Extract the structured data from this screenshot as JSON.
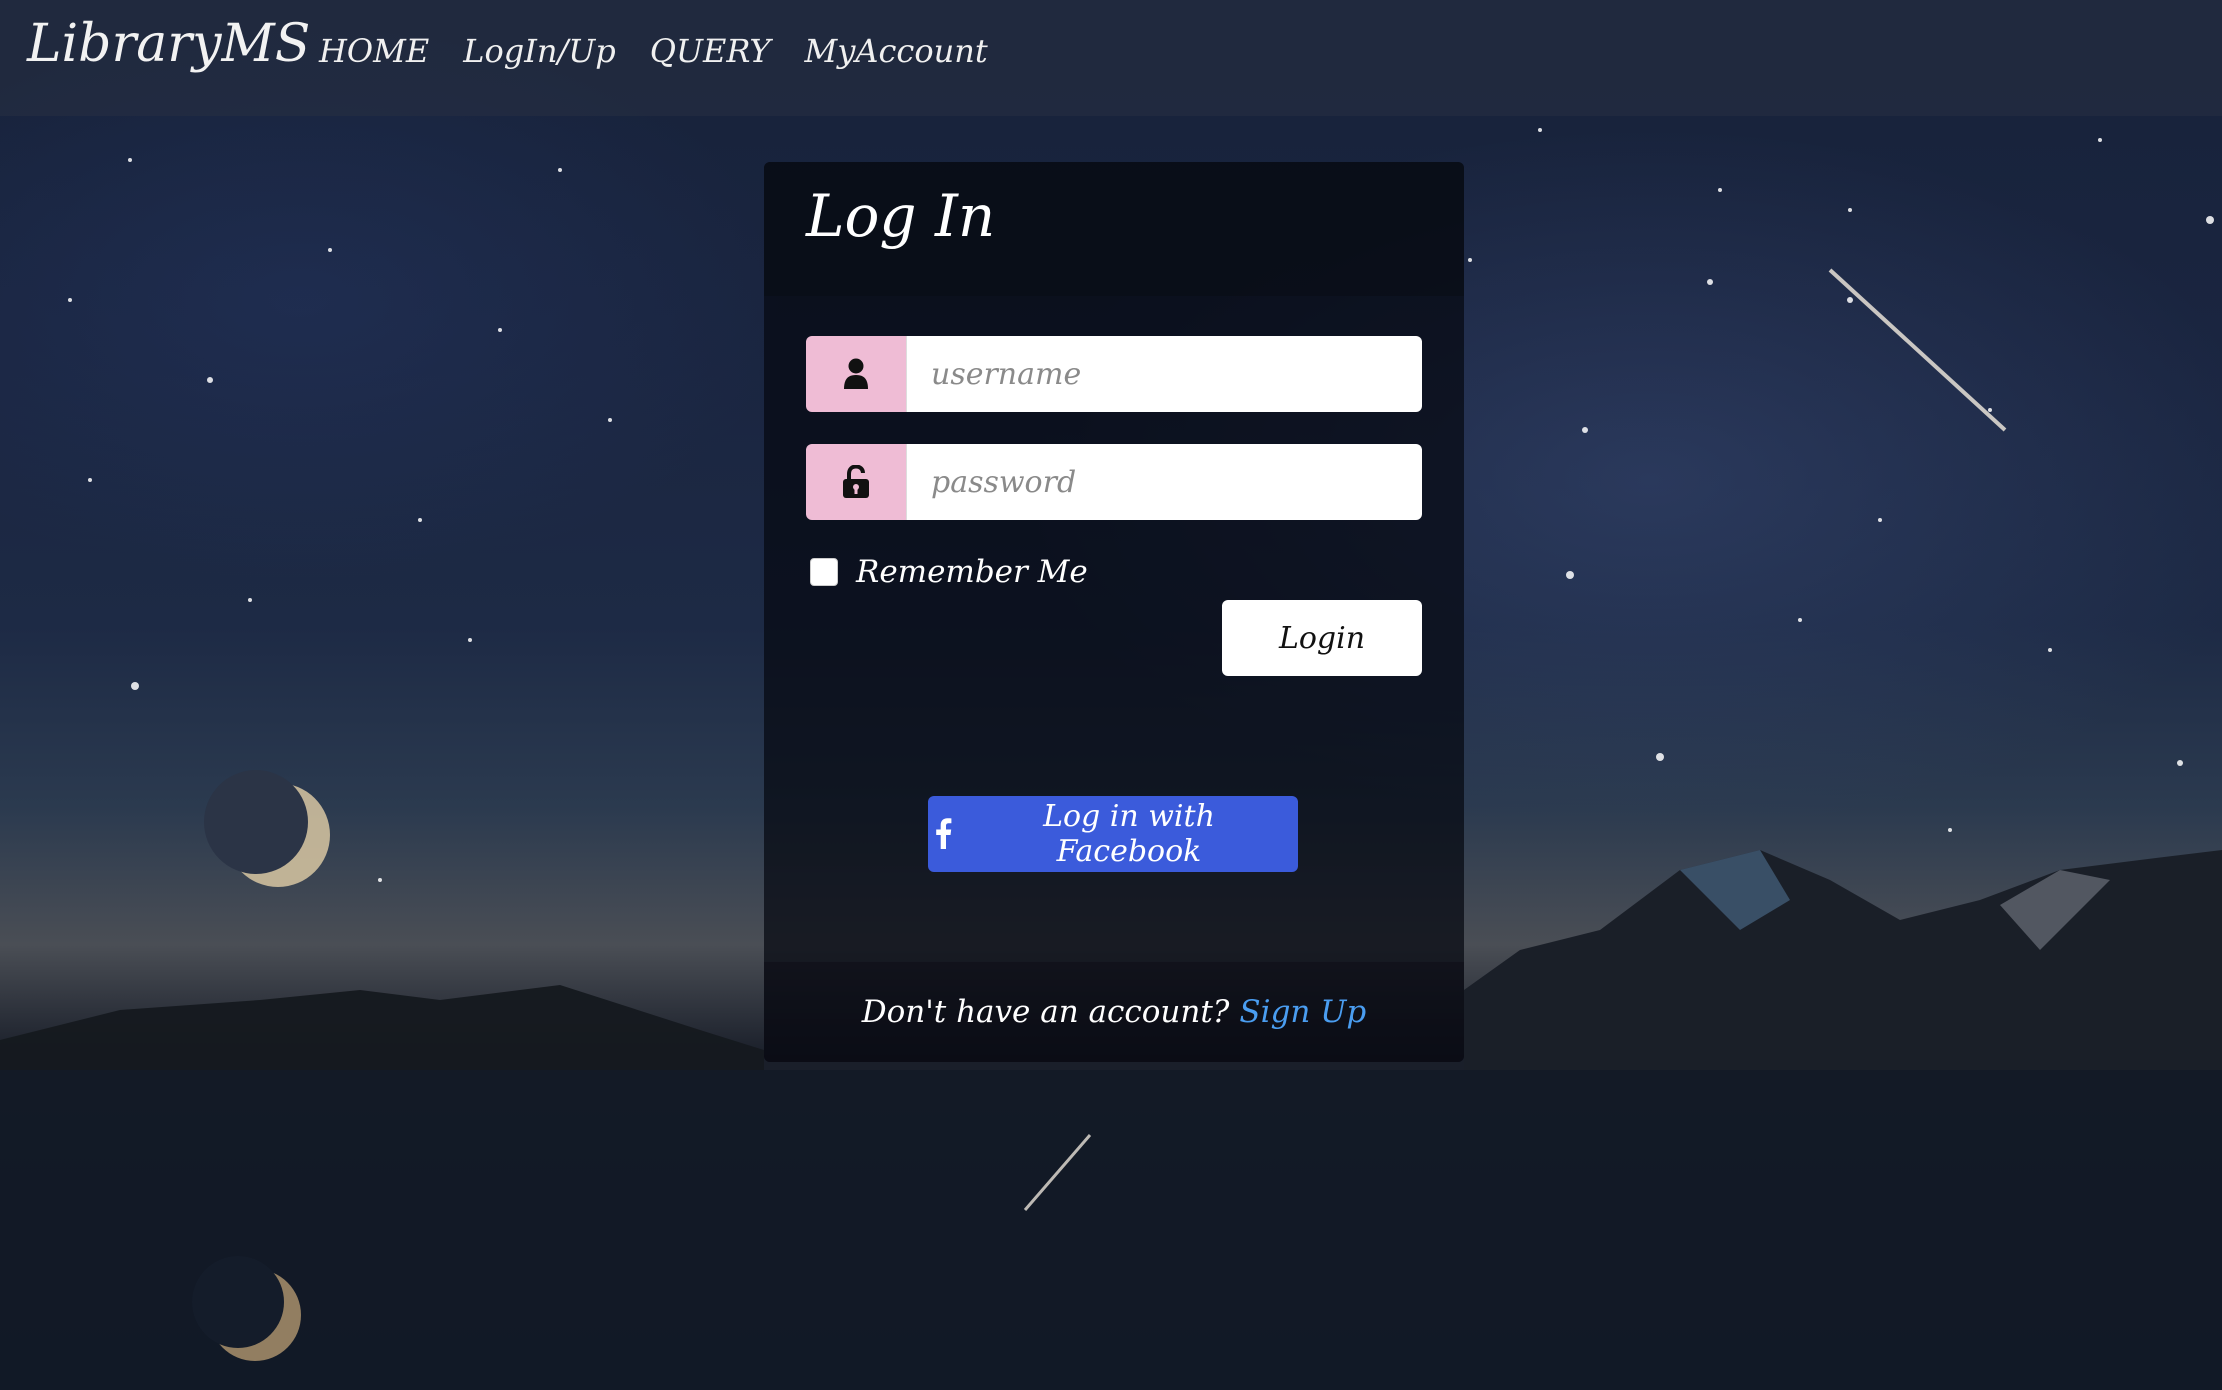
{
  "navbar": {
    "brand": "LibraryMS",
    "links": [
      {
        "label": "HOME"
      },
      {
        "label": "LogIn/Up"
      },
      {
        "label": "QUERY"
      },
      {
        "label": "MyAccount"
      }
    ]
  },
  "login_card": {
    "title": "Log In",
    "username": {
      "placeholder": "username",
      "value": "",
      "icon": "user-icon"
    },
    "password": {
      "placeholder": "password",
      "value": "",
      "icon": "unlock-icon"
    },
    "remember_me": {
      "label": "Remember Me",
      "checked": false
    },
    "login_button": "Login",
    "facebook_button": {
      "label": "Log in with Facebook",
      "icon": "facebook-icon"
    },
    "footer": {
      "text": "Don't have an account?",
      "link": "Sign Up"
    }
  },
  "colors": {
    "addon_pink": "#efbcd5",
    "facebook_blue": "#3b5bdb",
    "link_blue": "#4a9df0"
  }
}
